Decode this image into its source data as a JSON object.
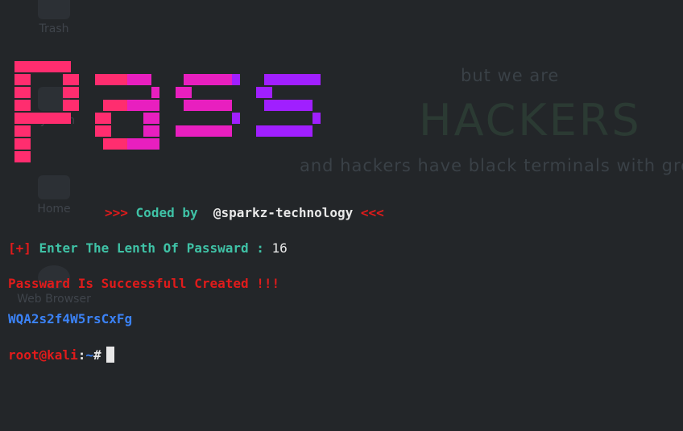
{
  "desktop": {
    "icons": [
      {
        "label": "Trash",
        "icon": "trash-icon"
      },
      {
        "label": "System",
        "icon": "system-icon"
      },
      {
        "label": "Home",
        "icon": "folder-icon"
      },
      {
        "label": "Web Browser",
        "icon": "browser-icon"
      }
    ],
    "wallpaper": {
      "line1": "but we are",
      "line2": "HACKERS",
      "line3": "and hackers have black terminals with green"
    }
  },
  "terminal": {
    "banner_word": "pass",
    "banner_colors": [
      "#ff2d6f",
      "#e81fbf",
      "#a01fff"
    ],
    "coded_by_open": ">>>",
    "coded_by_label": "Coded by",
    "coded_by_author": "@sparkz-technology",
    "coded_by_close": "<<<",
    "prompt_marker": "[+]",
    "prompt_text": "Enter The Lenth Of Passward :",
    "prompt_value": "16",
    "success_message": "Passward Is Successfull Created !!!",
    "generated_password": "WQA2s2f4W5rsCxFg",
    "shell_user": "root@kali",
    "shell_sep": ":",
    "shell_path": "~",
    "shell_symbol": "#"
  }
}
